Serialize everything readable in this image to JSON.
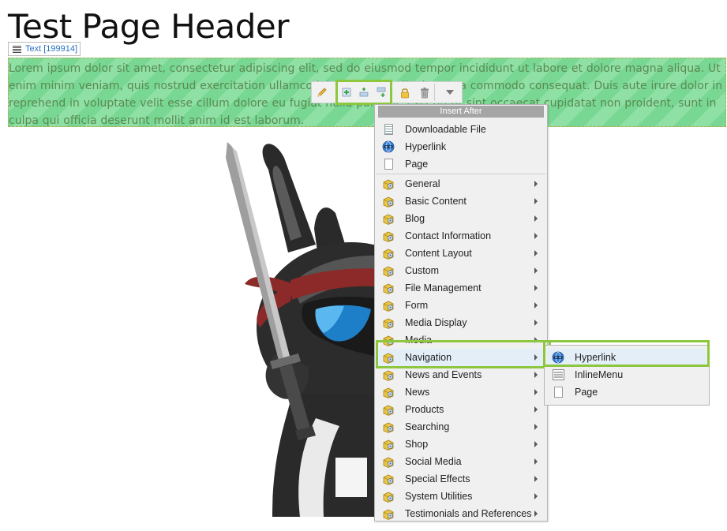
{
  "page": {
    "title": "Test Page Header",
    "content_tag": "Text [199914]",
    "paragraph": "Lorem ipsum dolor sit amet, consectetur adipiscing elit, sed do eiusmod tempor incididunt ut labore et dolore magna aliqua. Ut enim minim veniam, quis nostrud exercitation ullamco laboris nisi ut aliquip ex ea commodo consequat. Duis aute irure dolor in reprehend in voluptate velit esse cillum dolore eu fugiat nulla pariatur. Excepteur sint occaecat cupidatat non proident, sunt in culpa qui officia deserunt mollit anim id est laborum."
  },
  "toolbar": {
    "icons": [
      "pencil-icon",
      "insert-before-icon",
      "insert-inside-icon",
      "insert-after-icon",
      "lock-icon",
      "trash-icon",
      "dropdown-icon"
    ]
  },
  "menu": {
    "header": "Insert After",
    "top_items": [
      {
        "label": "Downloadable File",
        "icon": "file-icon"
      },
      {
        "label": "Hyperlink",
        "icon": "globe-icon"
      },
      {
        "label": "Page",
        "icon": "page-icon"
      }
    ],
    "categories": [
      {
        "label": "General"
      },
      {
        "label": "Basic Content"
      },
      {
        "label": "Blog"
      },
      {
        "label": "Contact Information"
      },
      {
        "label": "Content Layout"
      },
      {
        "label": "Custom"
      },
      {
        "label": "File Management"
      },
      {
        "label": "Form"
      },
      {
        "label": "Media Display"
      },
      {
        "label": "Media"
      },
      {
        "label": "Navigation"
      },
      {
        "label": "News and Events"
      },
      {
        "label": "News"
      },
      {
        "label": "Products"
      },
      {
        "label": "Searching"
      },
      {
        "label": "Shop"
      },
      {
        "label": "Social Media"
      },
      {
        "label": "Special Effects"
      },
      {
        "label": "System Utilities"
      },
      {
        "label": "Testimonials and References"
      }
    ]
  },
  "submenu": {
    "items": [
      {
        "label": "Hyperlink",
        "icon": "globe-icon"
      },
      {
        "label": "InlineMenu",
        "icon": "menu-icon"
      },
      {
        "label": "Page",
        "icon": "page-icon"
      }
    ]
  },
  "colors": {
    "highlight": "#8dc63f",
    "stripe_light": "#8fe0a5",
    "stripe_dark": "#79d794",
    "link": "#2b73c0"
  }
}
